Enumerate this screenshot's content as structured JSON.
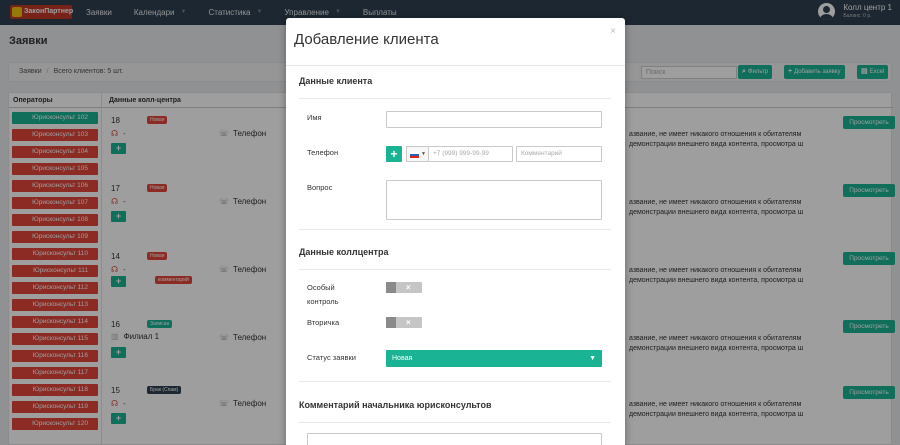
{
  "app": {
    "logo_text": "ЗаконПартнер",
    "nav": [
      {
        "label": "Заявки",
        "dropdown": false
      },
      {
        "label": "Календари",
        "dropdown": true
      },
      {
        "label": "Статистика",
        "dropdown": true
      },
      {
        "label": "Управление",
        "dropdown": true
      },
      {
        "label": "Выплаты",
        "dropdown": false
      }
    ],
    "user": {
      "name": "Колл центр 1",
      "balance": "Баланс: 0 р."
    }
  },
  "page": {
    "title": "Заявки",
    "breadcrumbs": [
      "Заявки",
      "Всего клиентов: 5 шт."
    ],
    "search_placeholder": "Поиск",
    "filter_label": "Фильтр",
    "add_client_label": "Добавить заявку",
    "excel_label": "Excel"
  },
  "table": {
    "headers": {
      "operators": "Операторы",
      "callcenter": "Данные колл-центра"
    },
    "operators": [
      {
        "label": "Юрисконсульт 102",
        "color": "#1ab394"
      },
      {
        "label": "Юрисконсульт 103",
        "color": "#e0463a"
      },
      {
        "label": "Юрисконсульт 104",
        "color": "#e0463a"
      },
      {
        "label": "Юрисконсульт 105",
        "color": "#e0463a"
      },
      {
        "label": "Юрисконсульт 106",
        "color": "#e0463a"
      },
      {
        "label": "Юрисконсульт 107",
        "color": "#e0463a"
      },
      {
        "label": "Юрисконсульт 108",
        "color": "#e0463a"
      },
      {
        "label": "Юрисконсульт 109",
        "color": "#e0463a"
      },
      {
        "label": "Юрисконсульт 110",
        "color": "#e0463a"
      },
      {
        "label": "Юрисконсульт 111",
        "color": "#e0463a"
      },
      {
        "label": "Юрисконсульт 112",
        "color": "#e0463a"
      },
      {
        "label": "Юрисконсульт 113",
        "color": "#e0463a"
      },
      {
        "label": "Юрисконсульт 114",
        "color": "#e0463a"
      },
      {
        "label": "Юрисконсульт 115",
        "color": "#e0463a"
      },
      {
        "label": "Юрисконсульт 116",
        "color": "#e0463a"
      },
      {
        "label": "Юрисконсульт 117",
        "color": "#e0463a"
      },
      {
        "label": "Юрисконсульт 118",
        "color": "#e0463a"
      },
      {
        "label": "Юрисконсульт 119",
        "color": "#e0463a"
      },
      {
        "label": "Юрисконсульт 120",
        "color": "#e0463a"
      }
    ],
    "rows": [
      {
        "num": "18",
        "status": "Новая",
        "status_color": "red",
        "dash": "-",
        "phone_label": "Телефон",
        "desc": [
          "азвание, не имеет никакого отношения к обитателям",
          "демонстрации внешнего вида контента, просмотра ш"
        ],
        "view_label": "Просмотреть"
      },
      {
        "num": "17",
        "status": "Новая",
        "status_color": "red",
        "dash": "-",
        "phone_label": "Телефон",
        "desc": [
          "азвание, не имеет никакого отношения к обитателям",
          "демонстрации внешнего вида контента, просмотра ш"
        ],
        "view_label": "Просмотреть"
      },
      {
        "num": "14",
        "status": "Новая",
        "status_color": "red",
        "dash": "-",
        "comment_badge": "комментарий",
        "phone_label": "Телефон",
        "desc": [
          "азвание, не имеет никакого отношения к обитателям",
          "демонстрации внешнего вида контента, просмотра ш"
        ],
        "view_label": "Просмотреть"
      },
      {
        "num": "16",
        "status": "Записан",
        "status_color": "green",
        "branch": "Филиал 1",
        "phone_label": "Телефон",
        "desc": [
          "азвание, не имеет никакого отношения к обитателям",
          "демонстрации внешнего вида контента, просмотра ш"
        ],
        "view_label": "Просмотреть"
      },
      {
        "num": "15",
        "status": "Брак (Спам)",
        "status_color": "dark",
        "dash": "-",
        "phone_label": "Телефон",
        "desc": [
          "азвание, не имеет никакого отношения к обитателям",
          "демонстрации внешнего вида контента, просмотра ш"
        ],
        "view_label": "Просмотреть"
      }
    ]
  },
  "modal": {
    "title": "Добавление клиента",
    "close": "×",
    "section_client": "Данные клиента",
    "name_label": "Имя",
    "name_value": "",
    "phone_label": "Телефон",
    "phone_placeholder": "+7 (999) 999-99-99",
    "comment_placeholder": "Комментарий",
    "question_label": "Вопрос",
    "section_callcenter": "Данные коллцентра",
    "special_label_1": "Особый",
    "special_label_2": "контроль",
    "secondary_label": "Вторичка",
    "status_label": "Статус заявки",
    "status_value": "Новая",
    "section_comment": "Комментарий начальника юрисконсультов"
  },
  "colors": {
    "accent": "#1ab394",
    "danger": "#e0463a",
    "nav_bg": "#2f4050"
  }
}
